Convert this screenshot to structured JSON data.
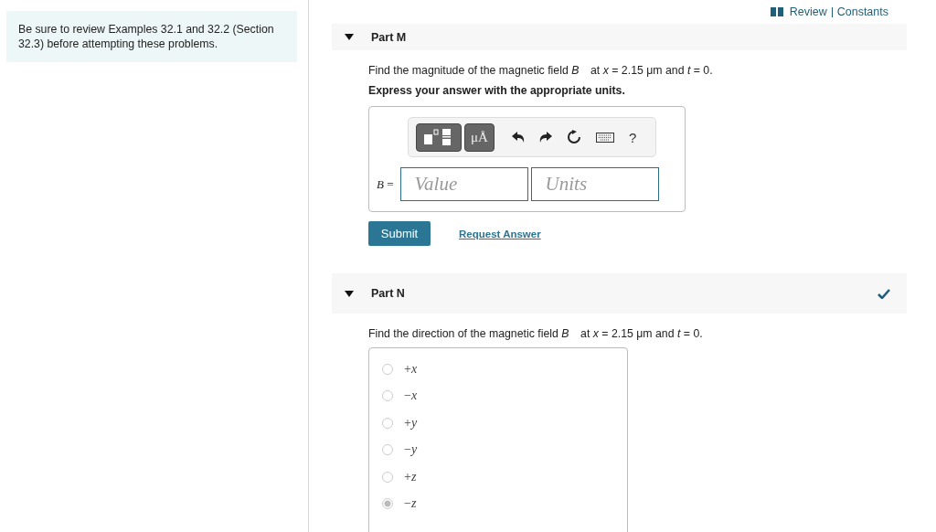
{
  "sidebar": {
    "note": "Be sure to review Examples 32.1 and 32.2 (Section 32.3) before attempting these problems."
  },
  "header_links": [
    "Review",
    "Constants"
  ],
  "parts": [
    {
      "kind": "answer",
      "title": "Part M",
      "expanded": true,
      "completed": false,
      "prompt": "Find the magnitude of the magnetic field *B⃗* at *x* = 2.15 μm and *t* = 0.",
      "instruction": "Express your answer with the appropriate units.",
      "toolbar": {
        "units_key": "μÅ",
        "help": "?"
      },
      "variable": "*B* =",
      "value_placeholder": "Value",
      "units_placeholder": "Units",
      "submit": "Submit",
      "request": "Request Answer"
    },
    {
      "kind": "choice",
      "title": "Part N",
      "expanded": true,
      "completed": true,
      "prompt": "Find the direction of the magnetic field *B⃗* at *x* = 2.15 μm and *t* = 0.",
      "disabled": true,
      "options": [
        {
          "label": "+*x*",
          "selected": false
        },
        {
          "label": "−*x*",
          "selected": false
        },
        {
          "label": "+*y*",
          "selected": false
        },
        {
          "label": "−*y*",
          "selected": false
        },
        {
          "label": "+*z*",
          "selected": false
        },
        {
          "label": "−*z*",
          "selected": true
        }
      ]
    }
  ]
}
